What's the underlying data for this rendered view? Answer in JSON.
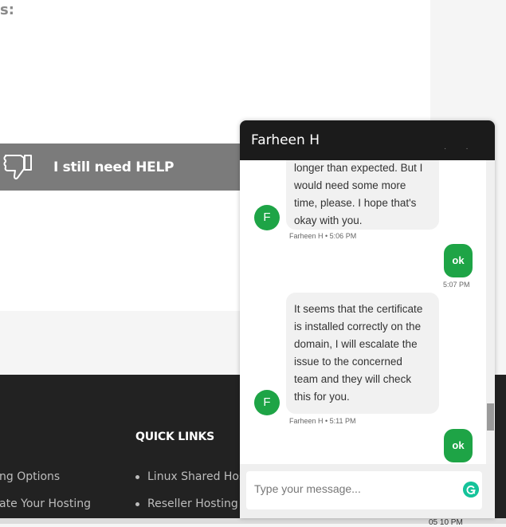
{
  "page": {
    "partial_heading": "s:",
    "help_button_label": "I still need HELP",
    "footer": {
      "quick_links_title": "QUICK LINKS",
      "left_column": [
        "ng Options",
        "ate Your Hosting"
      ],
      "quick_links": [
        "Linux Shared Host",
        "Reseller Hosting"
      ]
    },
    "clock_fragment": "05 10 PM"
  },
  "chat": {
    "agent_name": "Farheen H",
    "messages": [
      {
        "direction": "in",
        "lines": [
          "longer than expected. But I",
          "would need some more",
          "time, please. I hope that's",
          "okay with you."
        ],
        "avatar_letter": "F",
        "meta": "Farheen H • 5:06 PM"
      },
      {
        "direction": "out",
        "text": "ok",
        "meta": "5:07 PM"
      },
      {
        "direction": "in",
        "lines": [
          "It seems that the certificate",
          "is installed correctly on the",
          "domain, I will escalate the",
          "issue to the concerned",
          "team and they will check",
          "this for you."
        ],
        "avatar_letter": "F",
        "meta": "Farheen H • 5:11 PM"
      },
      {
        "direction": "out",
        "text": "ok"
      }
    ],
    "composer_placeholder": "Type your message...",
    "grammarly_icon": "grammarly-icon"
  },
  "colors": {
    "accent_green": "#1ea446",
    "header_dark": "#1b1b1b",
    "footer_dark": "#222222",
    "help_gray": "#7b7b7b"
  }
}
